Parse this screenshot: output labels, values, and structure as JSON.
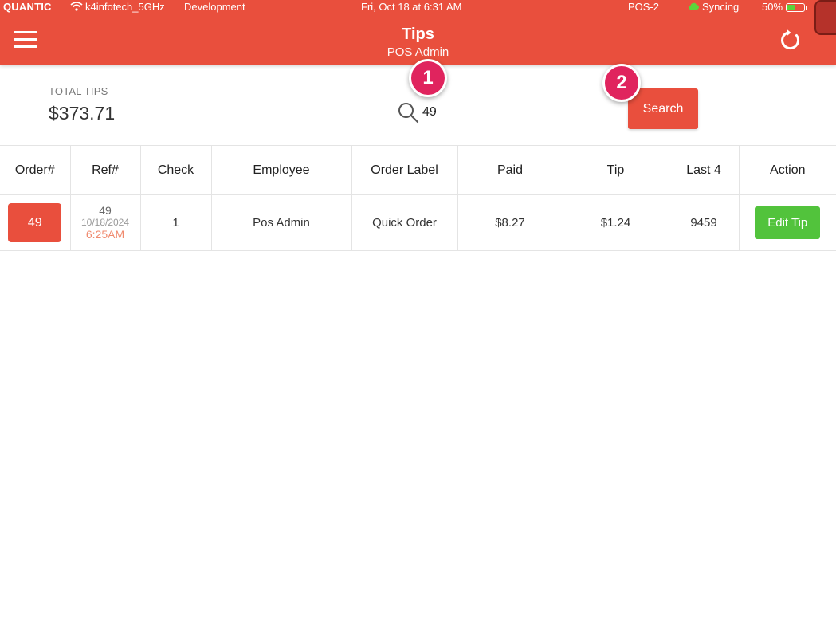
{
  "status_bar": {
    "brand": "QUANTIC",
    "wifi_icon": "wifi-icon",
    "ssid": "k4infotech_5GHz",
    "environment": "Development",
    "datetime": "Fri, Oct 18 at 6:31 AM",
    "pos": "POS-2",
    "sync_icon": "cloud-icon",
    "sync_status": "Syncing",
    "battery_percent": "50%",
    "battery_level": 0.5
  },
  "header": {
    "title": "Tips",
    "subtitle": "POS Admin",
    "menu_icon": "hamburger-menu-icon",
    "refresh_icon": "refresh-icon",
    "accent_color": "#e94f3d"
  },
  "summary": {
    "total_label": "TOTAL TIPS",
    "total_value": "$373.71"
  },
  "search": {
    "value": "49",
    "button_label": "Search",
    "icon": "search-icon"
  },
  "annotations": [
    "1",
    "2"
  ],
  "table": {
    "headers": [
      "Order#",
      "Ref#",
      "Check",
      "Employee",
      "Order Label",
      "Paid",
      "Tip",
      "Last 4",
      "Action"
    ],
    "rows": [
      {
        "order": "49",
        "ref": "49",
        "ref_date": "10/18/2024",
        "ref_time": "6:25AM",
        "check": "1",
        "employee": "Pos Admin",
        "order_label": "Quick Order",
        "paid": "$8.27",
        "tip": "$1.24",
        "last4": "9459",
        "action": "Edit Tip"
      }
    ]
  },
  "colors": {
    "primary": "#e94f3d",
    "success": "#52c33c",
    "badge": "#e0245e"
  }
}
